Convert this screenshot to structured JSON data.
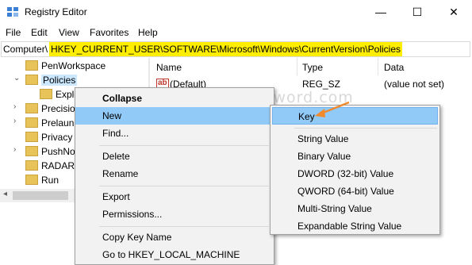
{
  "window": {
    "title": "Registry Editor",
    "minimize": "—",
    "maximize": "☐",
    "close": "✕"
  },
  "menubar": [
    "File",
    "Edit",
    "View",
    "Favorites",
    "Help"
  ],
  "address": {
    "label": "Computer\\",
    "path": "HKEY_CURRENT_USER\\SOFTWARE\\Microsoft\\Windows\\CurrentVersion\\Policies"
  },
  "tree": [
    "PenWorkspace",
    "Policies",
    "Explo",
    "Precisio",
    "Prelaun",
    "Privacy",
    "PushNo",
    "RADAR",
    "Run"
  ],
  "list": {
    "headers": [
      "Name",
      "Type",
      "Data"
    ],
    "rows": [
      {
        "name": "(Default)",
        "type": "REG_SZ",
        "data": "(value not set)",
        "icon": "ab"
      }
    ]
  },
  "context_menu": [
    "Collapse",
    "New",
    "Find...",
    "Delete",
    "Rename",
    "Export",
    "Permissions...",
    "Copy Key Name",
    "Go to HKEY_LOCAL_MACHINE"
  ],
  "context_submenu_arrow": "›",
  "new_submenu": [
    "Key",
    "String Value",
    "Binary Value",
    "DWORD (32-bit) Value",
    "QWORD (64-bit) Value",
    "Multi-String Value",
    "Expandable String Value"
  ],
  "watermark": "top-password.com",
  "colors": {
    "highlight": "#91c9f7",
    "address_highlight": "#ffee00",
    "arrow": "#f08a2c"
  }
}
